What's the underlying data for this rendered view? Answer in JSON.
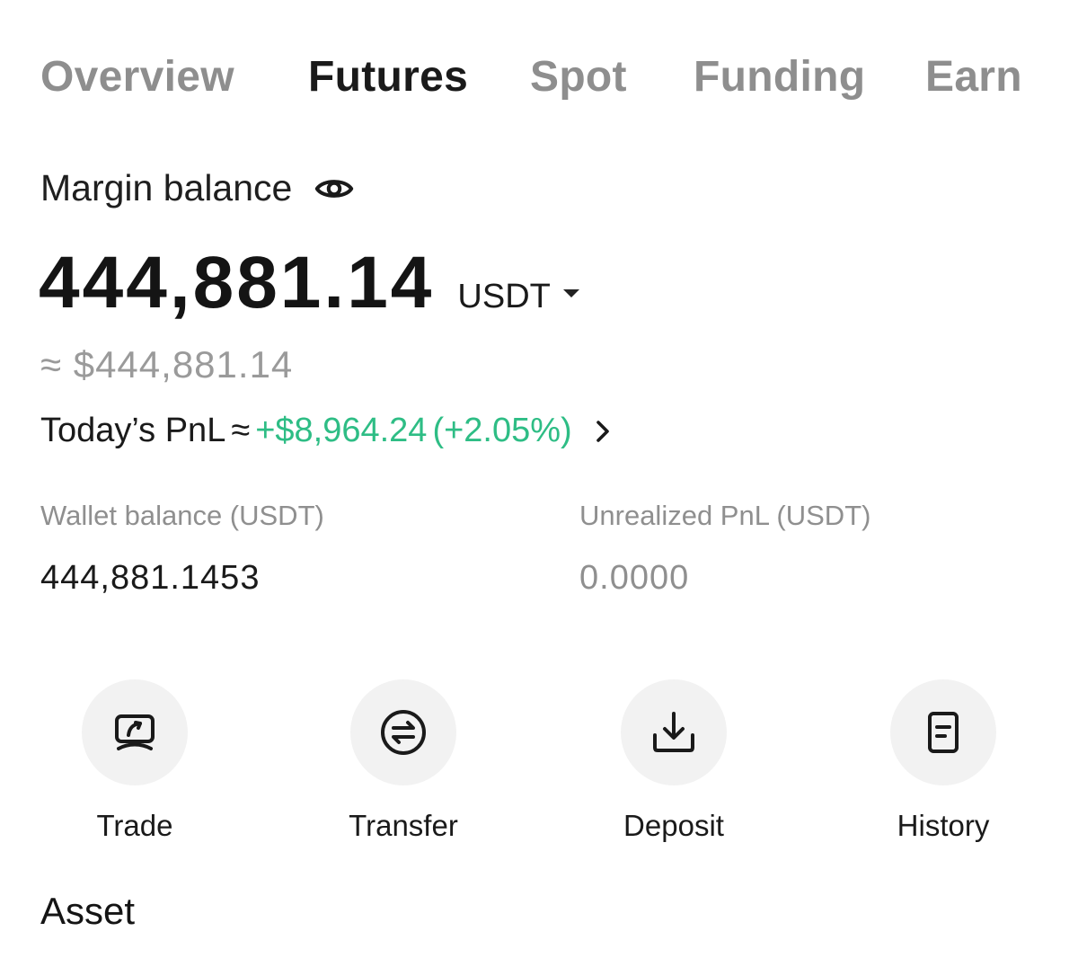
{
  "tabs": [
    {
      "label": "Overview",
      "active": false
    },
    {
      "label": "Futures",
      "active": true
    },
    {
      "label": "Spot",
      "active": false
    },
    {
      "label": "Funding",
      "active": false
    },
    {
      "label": "Earn",
      "active": false
    }
  ],
  "margin": {
    "label": "Margin balance",
    "visibility_icon": "eye-icon",
    "balance": "444,881.14",
    "currency": "USDT",
    "approx_usd": "≈ $444,881.14"
  },
  "pnl": {
    "label": "Today’s PnL",
    "approx": "≈",
    "value": "+$8,964.24",
    "percent": "(+2.05%)",
    "color_positive": "#2ebd85"
  },
  "stats": {
    "wallet": {
      "label": "Wallet balance (USDT)",
      "value": "444,881.1453"
    },
    "unrealized": {
      "label": "Unrealized PnL (USDT)",
      "value": "0.0000"
    }
  },
  "actions": [
    {
      "label": "Trade",
      "icon": "trade-icon"
    },
    {
      "label": "Transfer",
      "icon": "transfer-icon"
    },
    {
      "label": "Deposit",
      "icon": "deposit-icon"
    },
    {
      "label": "History",
      "icon": "history-icon"
    }
  ],
  "asset": {
    "title": "Asset"
  }
}
